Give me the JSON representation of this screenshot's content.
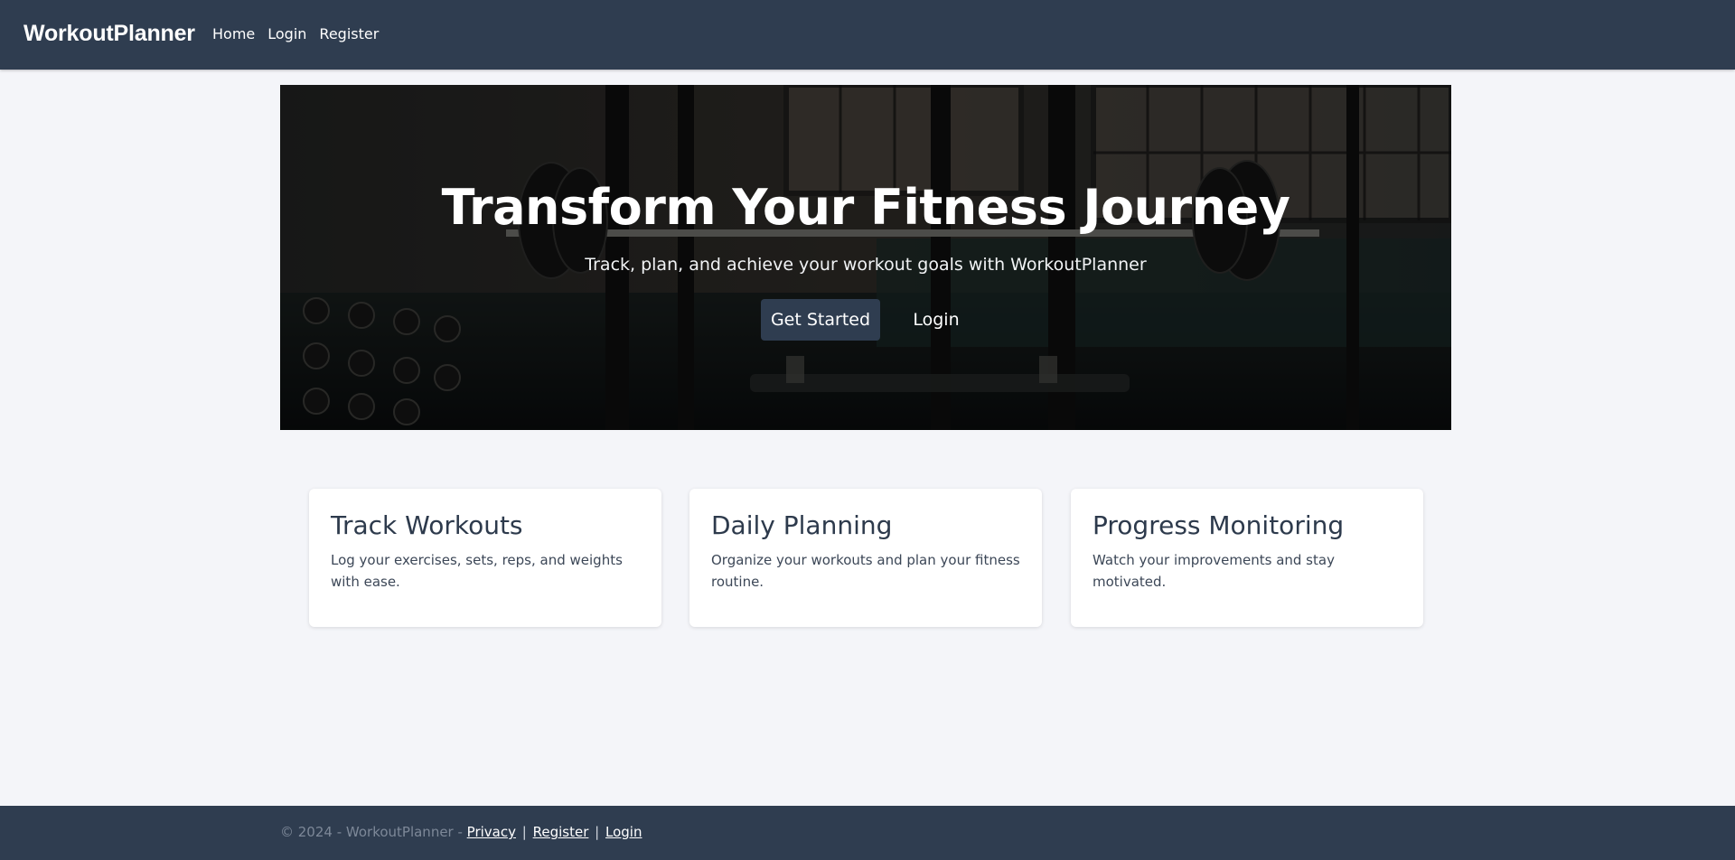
{
  "header": {
    "brand": "WorkoutPlanner",
    "nav": [
      "Home",
      "Login",
      "Register"
    ]
  },
  "hero": {
    "title": "Transform Your Fitness Journey",
    "subtitle": "Track, plan, and achieve your workout goals with WorkoutPlanner",
    "primary_button": "Get Started",
    "secondary_button": "Login"
  },
  "features": [
    {
      "title": "Track Workouts",
      "text": "Log your exercises, sets, reps, and weights with ease."
    },
    {
      "title": "Daily Planning",
      "text": "Organize your workouts and plan your fitness routine."
    },
    {
      "title": "Progress Monitoring",
      "text": "Watch your improvements and stay motivated."
    }
  ],
  "footer": {
    "copyright": "© 2024 - WorkoutPlanner - ",
    "links": [
      "Privacy",
      "Register",
      "Login"
    ],
    "separator": "|"
  },
  "colors": {
    "navbar": "#2f3d50",
    "page_background": "#f4f5f9",
    "primary_button": "#2f3d50"
  }
}
